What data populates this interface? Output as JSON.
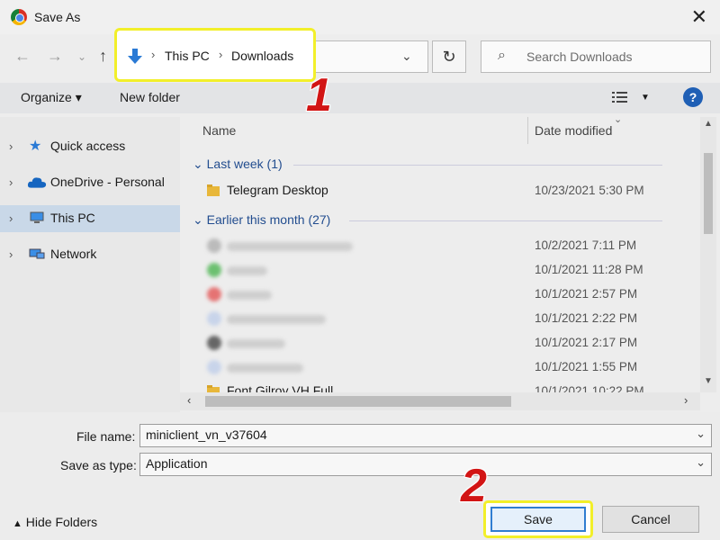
{
  "window": {
    "title": "Save As",
    "close_symbol": "✕"
  },
  "navigation": {
    "breadcrumbs": [
      "This PC",
      "Downloads"
    ],
    "search_placeholder": "Search Downloads",
    "refresh_symbol": "↻"
  },
  "toolbar": {
    "organize_label": "Organize",
    "new_folder_label": "New folder",
    "help_label": "?"
  },
  "sidebar": {
    "items": [
      {
        "label": "Quick access"
      },
      {
        "label": "OneDrive - Personal"
      },
      {
        "label": "This PC",
        "selected": true
      },
      {
        "label": "Network"
      }
    ]
  },
  "file_list": {
    "columns": [
      "Name",
      "Date modified"
    ],
    "groups": [
      {
        "label": "Last week (1)"
      },
      {
        "label": "Earlier this month (27)"
      }
    ],
    "files": [
      {
        "name": "Telegram Desktop",
        "date": "10/23/2021 5:30 PM"
      },
      {
        "name": "",
        "date": "10/2/2021 7:11 PM"
      },
      {
        "name": "",
        "date": "10/1/2021 11:28 PM"
      },
      {
        "name": "",
        "date": "10/1/2021 2:57 PM"
      },
      {
        "name": "",
        "date": "10/1/2021 2:22 PM"
      },
      {
        "name": "",
        "date": "10/1/2021 2:17 PM"
      },
      {
        "name": "",
        "date": "10/1/2021 1:55 PM"
      },
      {
        "name": "Font Gilroy VH Full",
        "date": "10/1/2021 10:22 PM"
      }
    ]
  },
  "form": {
    "file_name_label": "File name:",
    "file_name_value": "miniclient_vn_v37604",
    "save_type_label": "Save as type:",
    "save_type_value": "Application"
  },
  "footer": {
    "hide_folders_label": "Hide Folders",
    "save_label": "Save",
    "cancel_label": "Cancel"
  },
  "annotations": {
    "step1": "1",
    "step2": "2",
    "highlight_color": "#f2ef2a",
    "number_color": "#d21414"
  }
}
